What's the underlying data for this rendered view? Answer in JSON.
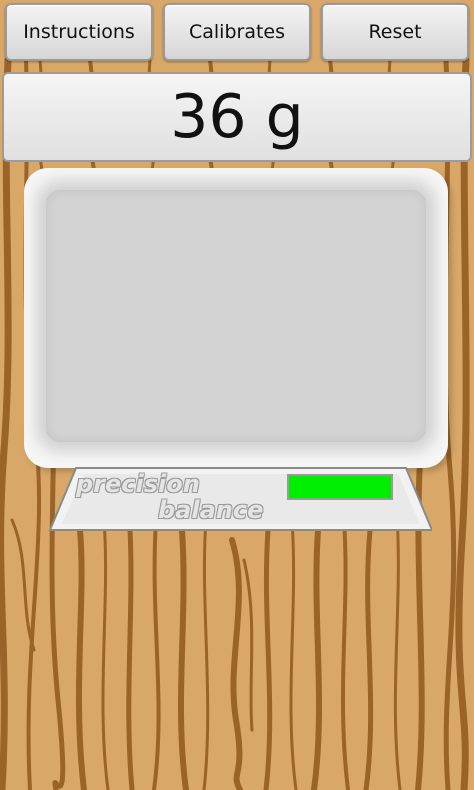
{
  "toolbar": {
    "instructions_label": "Instructions",
    "calibrates_label": "Calibrates",
    "reset_label": "Reset"
  },
  "display": {
    "weight_text": "36 g"
  },
  "scale": {
    "brand_line1": "precision",
    "brand_line2": "balance",
    "indicator_color": "#00ee00"
  },
  "colors": {
    "wood_light": "#d9a868",
    "wood_grain": "#9a6428"
  }
}
